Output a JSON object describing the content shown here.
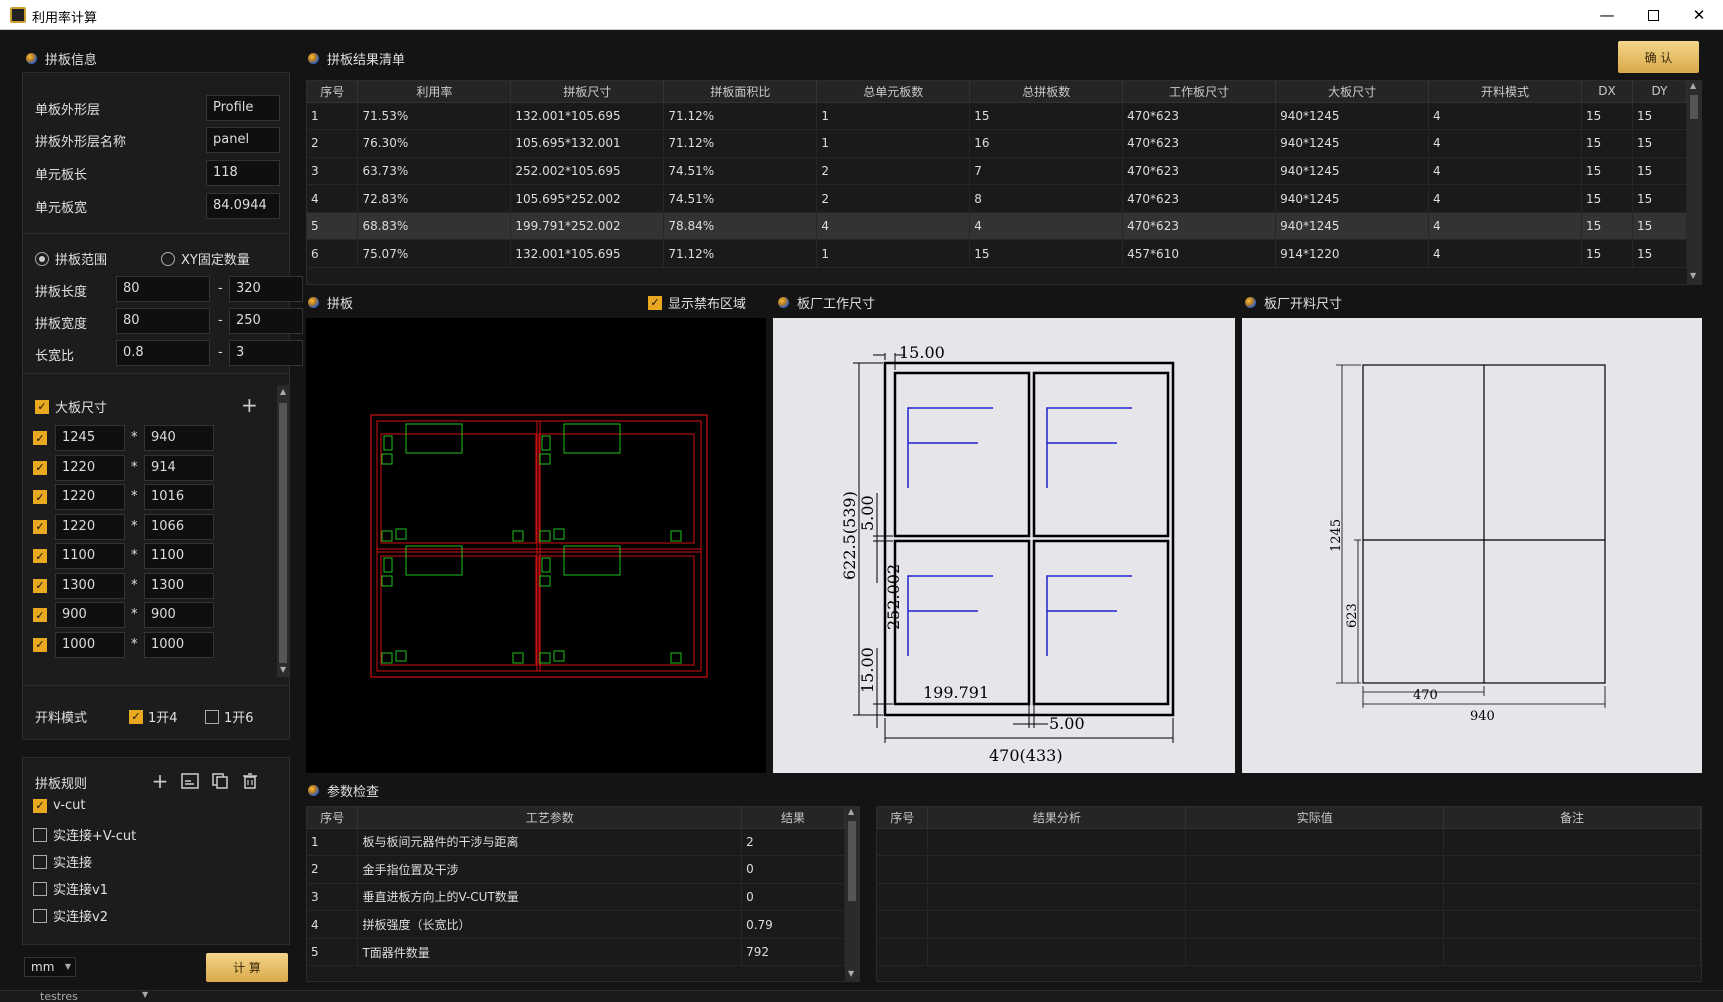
{
  "window": {
    "title": "利用率计算"
  },
  "left": {
    "info_title": "拼板信息",
    "fields": [
      {
        "label": "单板外形层",
        "value": "Profile"
      },
      {
        "label": "拼板外形层名称",
        "value": "panel"
      },
      {
        "label": "单元板长",
        "value": "118"
      },
      {
        "label": "单元板宽",
        "value": "84.0944"
      }
    ],
    "radio_range": "拼板范围",
    "radio_xy": "XY固定数量",
    "ranges": [
      {
        "label": "拼板长度",
        "min": "80",
        "max": "320"
      },
      {
        "label": "拼板宽度",
        "min": "80",
        "max": "250"
      },
      {
        "label": "长宽比",
        "min": "0.8",
        "max": "3"
      }
    ],
    "dash": "-",
    "big_title": "大板尺寸",
    "times": "*",
    "big_sizes": [
      {
        "a": "1245",
        "b": "940"
      },
      {
        "a": "1220",
        "b": "914"
      },
      {
        "a": "1220",
        "b": "1016"
      },
      {
        "a": "1220",
        "b": "1066"
      },
      {
        "a": "1100",
        "b": "1100"
      },
      {
        "a": "1300",
        "b": "1300"
      },
      {
        "a": "900",
        "b": "900"
      },
      {
        "a": "1000",
        "b": "1000"
      }
    ],
    "cut_mode_label": "开料模式",
    "cut_4": "1开4",
    "cut_6": "1开6",
    "rules_title": "拼板规则",
    "rules": [
      {
        "label": "v-cut",
        "checked": true
      },
      {
        "label": "实连接+V-cut",
        "checked": false
      },
      {
        "label": "实连接",
        "checked": false
      },
      {
        "label": "实连接v1",
        "checked": false
      },
      {
        "label": "实连接v2",
        "checked": false
      }
    ],
    "unit": "mm",
    "calc_button": "计 算",
    "status_text": "testres"
  },
  "results": {
    "title": "拼板结果清单",
    "confirm_button": "确 认",
    "headers": [
      "序号",
      "利用率",
      "拼板尺寸",
      "拼板面积比",
      "总单元板数",
      "总拼板数",
      "工作板尺寸",
      "大板尺寸",
      "开料模式",
      "DX",
      "DY"
    ],
    "rows": [
      [
        "1",
        "71.53%",
        "132.001*105.695",
        "71.12%",
        "1",
        "15",
        "470*623",
        "940*1245",
        "4",
        "15",
        "15"
      ],
      [
        "2",
        "76.30%",
        "105.695*132.001",
        "71.12%",
        "1",
        "16",
        "470*623",
        "940*1245",
        "4",
        "15",
        "15"
      ],
      [
        "3",
        "63.73%",
        "252.002*105.695",
        "74.51%",
        "2",
        "7",
        "470*623",
        "940*1245",
        "4",
        "15",
        "15"
      ],
      [
        "4",
        "72.83%",
        "105.695*252.002",
        "74.51%",
        "2",
        "8",
        "470*623",
        "940*1245",
        "4",
        "15",
        "15"
      ],
      [
        "5",
        "68.83%",
        "199.791*252.002",
        "78.84%",
        "4",
        "4",
        "470*623",
        "940*1245",
        "4",
        "15",
        "15"
      ],
      [
        "6",
        "75.07%",
        "132.001*105.695",
        "71.12%",
        "1",
        "15",
        "457*610",
        "914*1220",
        "4",
        "15",
        "15"
      ]
    ],
    "selected_row": 5
  },
  "previews": {
    "panel_title": "拼板",
    "show_forbidden": "显示禁布区域",
    "work_title": "板厂工作尺寸",
    "cut_title": "板厂开料尺寸",
    "work_dims": {
      "top": "15.00",
      "left_total": "622.5(539)",
      "mid_v": "5.00",
      "unit_h": "252.002",
      "bottom_v": "15.00",
      "unit_w": "199.791",
      "mid_h": "5.00",
      "bottom_total": "470(433)"
    },
    "cut_dims": {
      "h_total": "1245",
      "h_half": "623",
      "w_half": "470",
      "w_total": "940"
    }
  },
  "params": {
    "title": "参数检查",
    "headers": [
      "序号",
      "工艺参数",
      "结果"
    ],
    "rows": [
      [
        "1",
        "板与板间元器件的干涉与距离",
        "2"
      ],
      [
        "2",
        "金手指位置及干涉",
        "0"
      ],
      [
        "3",
        "垂直进板方向上的V-CUT数量",
        "0"
      ],
      [
        "4",
        "拼板强度（长宽比）",
        "0.79"
      ],
      [
        "5",
        "T面器件数量",
        "792"
      ]
    ],
    "analysis_headers": [
      "序号",
      "结果分析",
      "实际值",
      "备注"
    ]
  },
  "colors": {
    "accent": "#e8a820",
    "board_line": "#d01010",
    "pad": "#20c020",
    "fiducial_line": "#2020d0"
  }
}
